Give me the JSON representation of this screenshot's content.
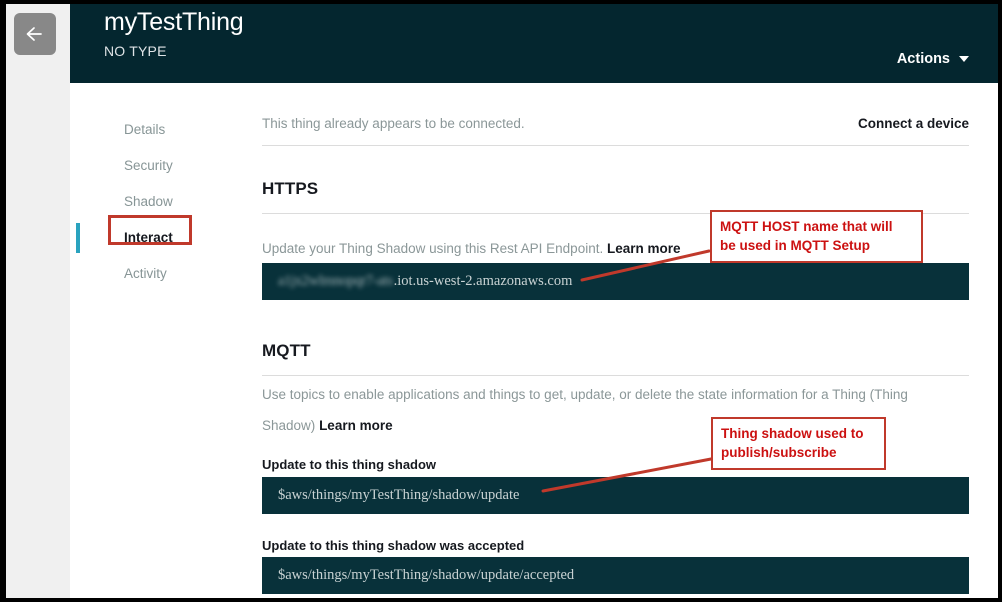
{
  "window": {
    "back_button_icon": "arrow-left-icon"
  },
  "header": {
    "title": "myTestThing",
    "subtitle": "NO TYPE",
    "actions_label": "Actions",
    "actions_caret_icon": "chevron-down-icon",
    "background_color": "#04262f"
  },
  "side_nav": {
    "active_indicator_color": "#2aa3bf",
    "highlight_border_color": "#c0392b",
    "items": [
      {
        "label": "Details",
        "active": false
      },
      {
        "label": "Security",
        "active": false
      },
      {
        "label": "Shadow",
        "active": false
      },
      {
        "label": "Interact",
        "active": true
      },
      {
        "label": "Activity",
        "active": false
      }
    ]
  },
  "main": {
    "connected_status": "This thing already appears to be connected.",
    "connect_device_link": "Connect a device",
    "https": {
      "heading": "HTTPS",
      "description": "Update your Thing Shadow using this Rest API Endpoint.",
      "learn_more": "Learn more",
      "endpoint_blurred_prefix": "a1jx2wlmnopqr7-ats",
      "endpoint_suffix": ".iot.us-west-2.amazonaws.com"
    },
    "mqtt": {
      "heading": "MQTT",
      "description": "Use topics to enable applications and things to get, update, or delete the state information for a Thing (Thing Shadow)",
      "learn_more": "Learn more",
      "topics": [
        {
          "label": "Update to this thing shadow",
          "value": "$aws/things/myTestThing/shadow/update"
        },
        {
          "label": "Update to this thing shadow was accepted",
          "value": "$aws/things/myTestThing/shadow/update/accepted"
        }
      ]
    }
  },
  "annotations": [
    {
      "id": "mqtt-host-annotation",
      "line1": "MQTT HOST name that will",
      "line2": "be used in MQTT Setup"
    },
    {
      "id": "thing-shadow-annotation",
      "line1": "Thing shadow used to",
      "line2": "publish/subscribe"
    }
  ],
  "colors": {
    "annotation_red": "#cc1111",
    "annotation_border": "#c0392b",
    "dark_field": "#08313a",
    "accent_teal": "#2aa3bf"
  }
}
